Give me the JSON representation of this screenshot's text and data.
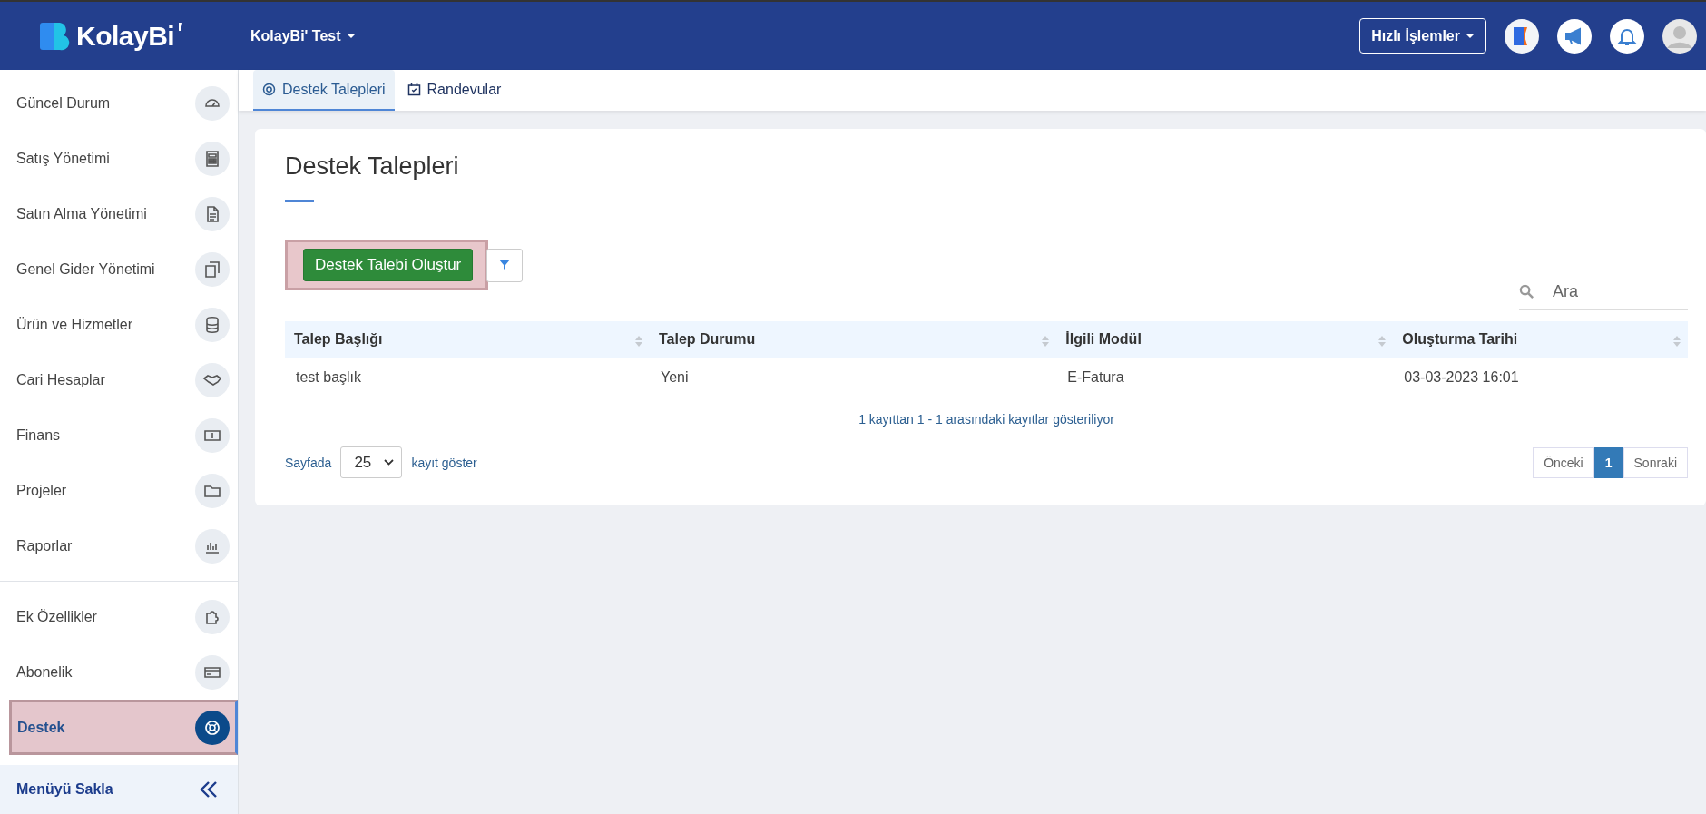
{
  "header": {
    "logo": "KolayBi",
    "company": "KolayBi' Test",
    "quick_actions": "Hızlı İşlemler"
  },
  "tabs": [
    {
      "label": "Destek Talepleri",
      "selected": true
    },
    {
      "label": "Randevular",
      "selected": false
    }
  ],
  "sidebar": {
    "groups": [
      [
        {
          "label": "Güncel Durum",
          "selected": false
        },
        {
          "label": "Satış Yönetimi",
          "selected": false
        },
        {
          "label": "Satın Alma Yönetimi",
          "selected": false
        },
        {
          "label": "Genel Gider Yönetimi",
          "selected": false
        },
        {
          "label": "Ürün ve Hizmetler",
          "selected": false
        },
        {
          "label": "Cari Hesaplar",
          "selected": false
        },
        {
          "label": "Finans",
          "selected": false
        },
        {
          "label": "Projeler",
          "selected": false
        },
        {
          "label": "Raporlar",
          "selected": false
        }
      ],
      [
        {
          "label": "Ek Özellikler",
          "selected": false
        },
        {
          "label": "Abonelik",
          "selected": false
        },
        {
          "label": "Destek",
          "selected": true
        }
      ]
    ],
    "footer": "Menüyü Sakla"
  },
  "page": {
    "title": "Destek Talepleri",
    "create_button": "Destek Talebi Oluştur",
    "search": {
      "placeholder": "Ara"
    },
    "table": {
      "columns": [
        "Talep Başlığı",
        "Talep Durumu",
        "İlgili Modül",
        "Oluşturma Tarihi"
      ],
      "rows": [
        [
          "test başlık",
          "Yeni",
          "E-Fatura",
          "03-03-2023 16:01"
        ]
      ]
    },
    "info": "1 kayıttan 1 - 1 arasındaki kayıtlar gösteriliyor",
    "length": {
      "before": "Sayfada",
      "value": "25",
      "after": "kayıt göster"
    },
    "pagination": {
      "previous": "Önceki",
      "pages": [
        {
          "label": "1",
          "selected": true
        }
      ],
      "next": "Sonraki"
    }
  }
}
